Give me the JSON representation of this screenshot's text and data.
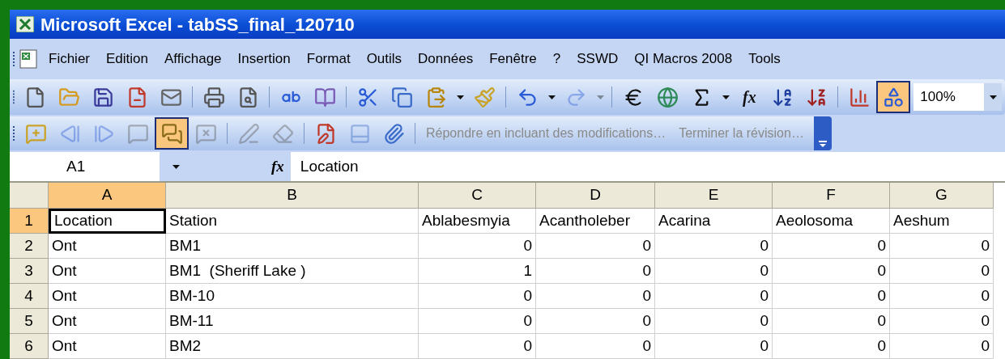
{
  "window": {
    "title": "Microsoft Excel - tabSS_final_120710"
  },
  "menu": [
    "Fichier",
    "Edition",
    "Affichage",
    "Insertion",
    "Format",
    "Outils",
    "Données",
    "Fenêtre",
    "?",
    "SSWD",
    "QI Macros 2008",
    "Tools"
  ],
  "standard_toolbar": {
    "groups": [
      [
        {
          "kind": "new",
          "pressed": false,
          "disabled": false
        },
        {
          "kind": "open",
          "pressed": false,
          "disabled": false
        },
        {
          "kind": "save",
          "pressed": false,
          "disabled": false
        },
        {
          "kind": "permission",
          "pressed": false,
          "disabled": false
        },
        {
          "kind": "mail",
          "pressed": false,
          "disabled": false
        }
      ],
      [
        {
          "kind": "print",
          "pressed": false,
          "disabled": false
        },
        {
          "kind": "preview",
          "pressed": false,
          "disabled": false
        }
      ],
      [
        {
          "kind": "spelling",
          "pressed": false,
          "disabled": false
        },
        {
          "kind": "research",
          "pressed": false,
          "disabled": false
        }
      ],
      [
        {
          "kind": "cut",
          "pressed": false,
          "disabled": false
        },
        {
          "kind": "copy",
          "pressed": false,
          "disabled": false
        },
        {
          "kind": "paste",
          "pressed": false,
          "disabled": false
        },
        {
          "kind": "caret",
          "pressed": false,
          "disabled": false
        },
        {
          "kind": "painter",
          "pressed": false,
          "disabled": false
        }
      ],
      [
        {
          "kind": "undo",
          "pressed": false,
          "disabled": false
        },
        {
          "kind": "caret",
          "pressed": false,
          "disabled": false
        },
        {
          "kind": "redo",
          "pressed": false,
          "disabled": true
        },
        {
          "kind": "caret",
          "pressed": false,
          "disabled": true
        }
      ],
      [
        {
          "kind": "euro",
          "pressed": false,
          "disabled": false
        },
        {
          "kind": "hyperlink",
          "pressed": false,
          "disabled": false
        },
        {
          "kind": "sum",
          "pressed": false,
          "disabled": false
        },
        {
          "kind": "caret",
          "pressed": false,
          "disabled": false
        },
        {
          "kind": "function",
          "label": "fx",
          "pressed": false,
          "disabled": false
        },
        {
          "kind": "sort_asc",
          "pressed": false,
          "disabled": false
        },
        {
          "kind": "sort_desc",
          "pressed": false,
          "disabled": false
        }
      ],
      [
        {
          "kind": "chart",
          "pressed": false,
          "disabled": false
        },
        {
          "kind": "drawing",
          "pressed": true,
          "disabled": false
        }
      ]
    ],
    "zoom": "100%"
  },
  "reviewing_toolbar": {
    "groups": [
      [
        {
          "kind": "new_comment",
          "pressed": false,
          "disabled": false
        },
        {
          "kind": "previous",
          "pressed": false,
          "disabled": true
        },
        {
          "kind": "next",
          "pressed": false,
          "disabled": true
        },
        {
          "kind": "show_comment",
          "pressed": false,
          "disabled": true
        },
        {
          "kind": "show_all",
          "pressed": true,
          "disabled": false
        },
        {
          "kind": "delete_comment",
          "pressed": false,
          "disabled": true
        }
      ],
      [
        {
          "kind": "ink",
          "pressed": false,
          "disabled": true
        },
        {
          "kind": "delete_ink",
          "pressed": false,
          "disabled": true
        }
      ],
      [
        {
          "kind": "track_changes",
          "pressed": false,
          "disabled": false
        },
        {
          "kind": "reviewing_pane",
          "pressed": false,
          "disabled": true
        },
        {
          "kind": "send",
          "pressed": false,
          "disabled": false
        }
      ],
      [
        {
          "kind": "text",
          "label": "Répondre en incluant des modifications…",
          "pressed": false,
          "disabled": true
        },
        {
          "kind": "text",
          "label": "Terminer la révision…",
          "pressed": false,
          "disabled": true
        }
      ]
    ]
  },
  "formula_bar": {
    "name_box": "A1",
    "fx_label": "fx",
    "content": "Location"
  },
  "grid": {
    "columns": [
      {
        "letter": "A",
        "selected": true
      },
      {
        "letter": "B",
        "selected": false
      },
      {
        "letter": "C",
        "selected": false
      },
      {
        "letter": "D",
        "selected": false
      },
      {
        "letter": "E",
        "selected": false
      },
      {
        "letter": "F",
        "selected": false
      },
      {
        "letter": "G",
        "selected": false
      }
    ],
    "rows": [
      {
        "number": "1",
        "kind": "header",
        "selected": true,
        "cells": [
          "Location",
          "Station",
          "Ablabesmyia",
          "Acantholeber",
          "Acarina",
          "Aeolosoma",
          "Aeshum"
        ]
      },
      {
        "number": "2",
        "kind": "data",
        "selected": false,
        "cells": [
          "Ont",
          "BM1",
          "0",
          "0",
          "0",
          "0",
          "0"
        ]
      },
      {
        "number": "3",
        "kind": "data",
        "selected": false,
        "cells": [
          "Ont",
          "BM1  (Sheriff Lake )",
          "1",
          "0",
          "0",
          "0",
          "0"
        ]
      },
      {
        "number": "4",
        "kind": "data",
        "selected": false,
        "cells": [
          "Ont",
          "BM-10",
          "0",
          "0",
          "0",
          "0",
          "0"
        ]
      },
      {
        "number": "5",
        "kind": "data",
        "selected": false,
        "cells": [
          "Ont",
          "BM-11",
          "0",
          "0",
          "0",
          "0",
          "0"
        ]
      },
      {
        "number": "6",
        "kind": "data",
        "selected": false,
        "cells": [
          "Ont",
          "BM2",
          "0",
          "0",
          "0",
          "0",
          "0"
        ]
      }
    ]
  }
}
